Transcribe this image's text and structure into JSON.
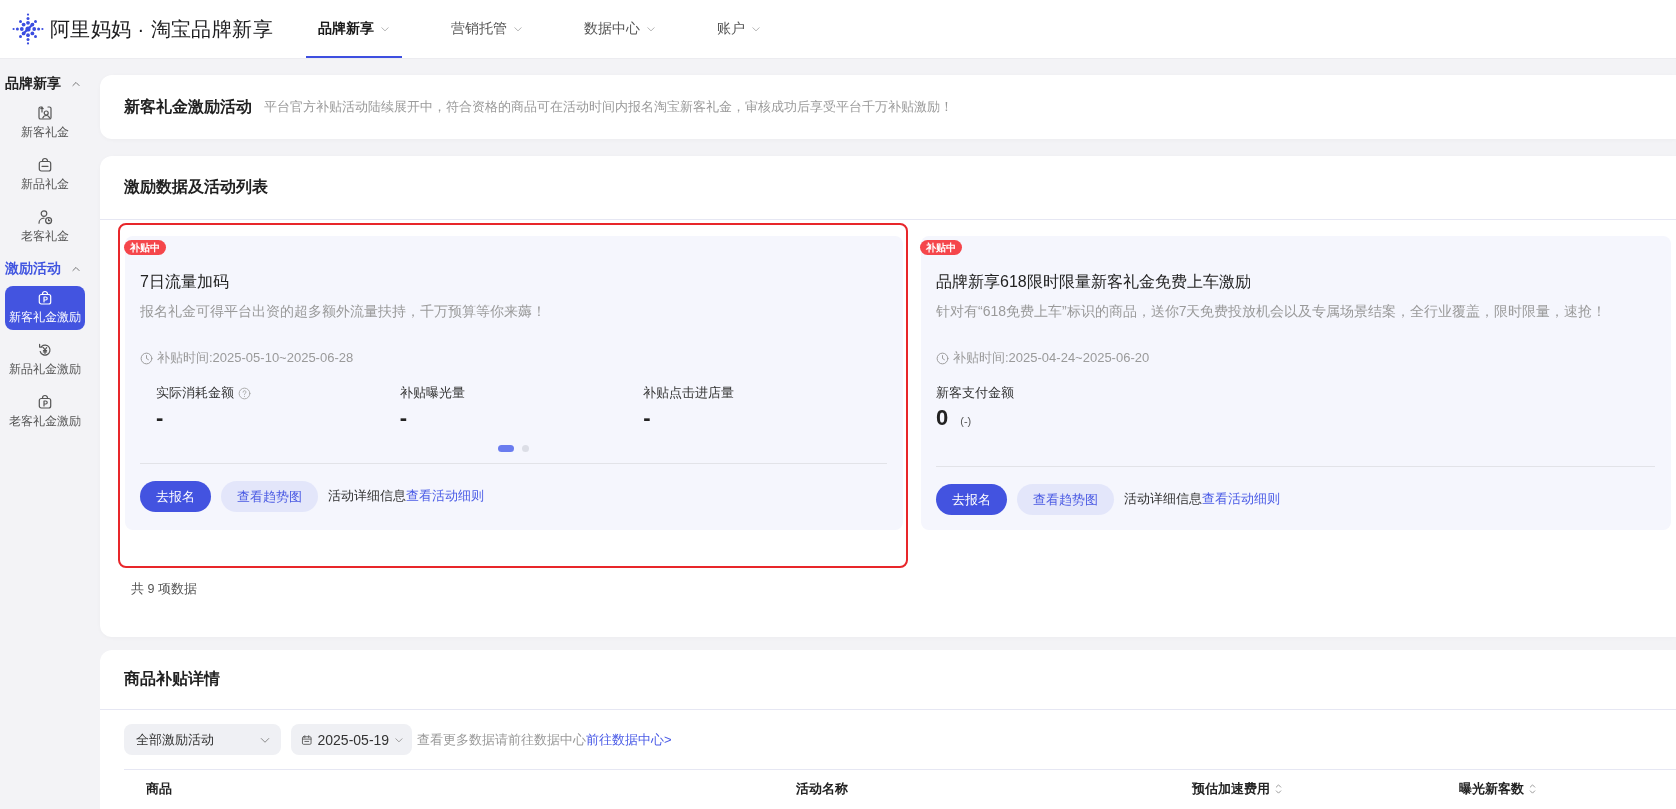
{
  "header": {
    "brand": "阿里妈妈 · 淘宝品牌新享",
    "nav": [
      {
        "label": "品牌新享",
        "selected": true
      },
      {
        "label": "营销托管",
        "selected": false
      },
      {
        "label": "数据中心",
        "selected": false
      },
      {
        "label": "账户",
        "selected": false
      }
    ]
  },
  "sidebar": {
    "sections": [
      {
        "title": "品牌新享",
        "expanded": true,
        "items": [
          {
            "label": "新客礼金",
            "selected": false
          },
          {
            "label": "新品礼金",
            "selected": false
          },
          {
            "label": "老客礼金",
            "selected": false
          }
        ]
      },
      {
        "title": "激励活动",
        "expanded": true,
        "items": [
          {
            "label": "新客礼金激励",
            "selected": true
          },
          {
            "label": "新品礼金激励",
            "selected": false
          },
          {
            "label": "老客礼金激励",
            "selected": false
          }
        ]
      }
    ]
  },
  "intro": {
    "title": "新客礼金激励活动",
    "description": "平台官方补贴活动陆续展开中，符合资格的商品可在活动时间内报名淘宝新客礼金，审核成功后享受平台千万补贴激励！"
  },
  "activities": {
    "title": "激励数据及活动列表",
    "cards": [
      {
        "badge": "补贴中",
        "highlighted": true,
        "title": "7日流量加码",
        "description": "报名礼金可得平台出资的超多额外流量扶持，千万预算等你来薅！",
        "period": "补贴时间:2025-05-10~2025-06-28",
        "metrics": [
          {
            "label": "实际消耗金额",
            "help": true,
            "value": "-"
          },
          {
            "label": "补贴曝光量",
            "help": false,
            "value": "-"
          },
          {
            "label": "补贴点击进店量",
            "help": false,
            "value": "-"
          }
        ],
        "pager": [
          {
            "selected": true
          },
          {
            "selected": false
          }
        ],
        "actions": {
          "primary": "去报名",
          "secondary": "查看趋势图",
          "note": "活动详细信息",
          "link": "查看活动细则"
        }
      },
      {
        "badge": "补贴中",
        "highlighted": false,
        "title": "品牌新享618限时限量新客礼金免费上车激励",
        "description": "针对有“618免费上车”标识的商品，送你7天免费投放机会以及专属场景结案，全行业覆盖，限时限量，速抢！",
        "period": "补贴时间:2025-04-24~2025-06-20",
        "metrics": [
          {
            "label": "新客支付金额",
            "help": false,
            "value": "0",
            "change": "(-)"
          }
        ],
        "actions": {
          "primary": "去报名",
          "secondary": "查看趋势图",
          "note": "活动详细信息",
          "link": "查看活动细则"
        }
      }
    ],
    "total": "共 9 项数据"
  },
  "subsidy_details": {
    "title": "商品补贴详情",
    "activity_filter": {
      "value": "全部激励活动"
    },
    "date_filter": {
      "value": "2025-05-19"
    },
    "hint": "查看更多数据请前往数据中心",
    "link": "前往数据中心>",
    "table": {
      "columns": [
        {
          "label": "商品",
          "sortable": false
        },
        {
          "label": "活动名称",
          "sortable": false
        },
        {
          "label": "预估加速费用",
          "sortable": true
        },
        {
          "label": "曝光新客数",
          "sortable": true
        }
      ]
    }
  }
}
